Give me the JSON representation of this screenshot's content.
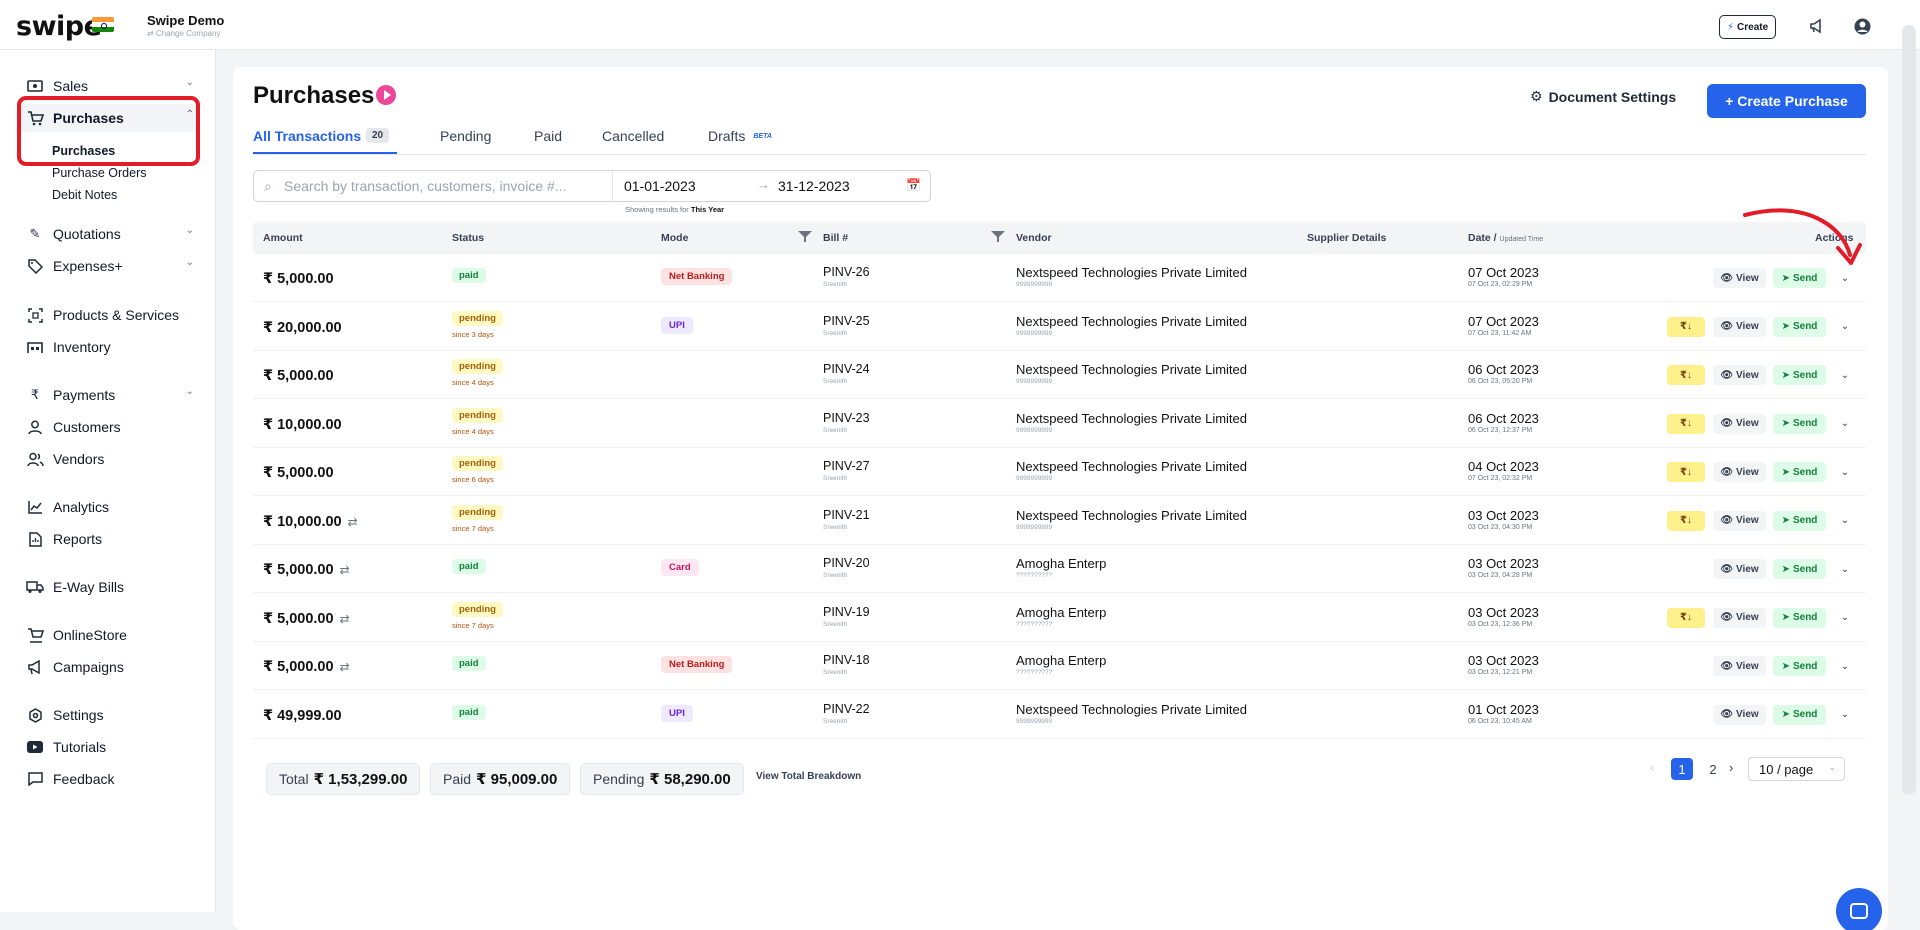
{
  "topbar": {
    "logo": "swipe",
    "company_name": "Swipe Demo",
    "change_company": "⇄ Change Company",
    "create_label": "Create"
  },
  "sidebar": {
    "items": [
      {
        "label": "Sales",
        "icon": "cash-icon",
        "chevron": "⌄"
      },
      {
        "label": "Purchases",
        "icon": "cart-icon",
        "chevron": "⌃"
      },
      {
        "label": "Quotations",
        "icon": "pen-icon",
        "chevron": "⌄"
      },
      {
        "label": "Expenses+",
        "icon": "tag-icon",
        "chevron": "⌄"
      },
      {
        "label": "Products & Services",
        "icon": "box-icon"
      },
      {
        "label": "Inventory",
        "icon": "warehouse-icon"
      },
      {
        "label": "Payments",
        "icon": "rupee-icon",
        "chevron": "⌄"
      },
      {
        "label": "Customers",
        "icon": "user-icon"
      },
      {
        "label": "Vendors",
        "icon": "users-icon"
      },
      {
        "label": "Analytics",
        "icon": "chart-icon"
      },
      {
        "label": "Reports",
        "icon": "report-icon"
      },
      {
        "label": "E-Way Bills",
        "icon": "truck-icon"
      },
      {
        "label": "OnlineStore",
        "icon": "store-icon"
      },
      {
        "label": "Campaigns",
        "icon": "megaphone-icon"
      },
      {
        "label": "Settings",
        "icon": "gear-icon"
      },
      {
        "label": "Tutorials",
        "icon": "youtube-icon"
      },
      {
        "label": "Feedback",
        "icon": "message-icon"
      }
    ],
    "sub_items": [
      "Purchases",
      "Purchase Orders",
      "Debit Notes"
    ]
  },
  "header": {
    "title": "Purchases",
    "doc_settings": "Document Settings",
    "create_purchase": "+ Create Purchase"
  },
  "tabs": {
    "all": "All Transactions",
    "all_count": "20",
    "pending": "Pending",
    "paid": "Paid",
    "cancelled": "Cancelled",
    "drafts": "Drafts",
    "beta": "BETA"
  },
  "filters": {
    "search_placeholder": "Search by transaction, customers, invoice #...",
    "date_from": "01-01-2023",
    "date_to": "31-12-2023",
    "showing_prefix": "Showing results for",
    "showing_period": "This Year"
  },
  "table": {
    "headers": {
      "amount": "Amount",
      "status": "Status",
      "mode": "Mode",
      "bill": "Bill #",
      "vendor": "Vendor",
      "supplier": "Supplier Details",
      "date": "Date /",
      "date_small": "Updated Time",
      "actions": "Actions"
    },
    "rows": [
      {
        "amount": "₹ 5,000.00",
        "repeat": "",
        "status": "paid",
        "since": "",
        "mode": "Net Banking",
        "mode_type": "net",
        "bill": "PINV-26",
        "bill_sub": "Sreenith",
        "vendor": "Nextspeed Technologies Private Limited",
        "vendor_sub": "9999999999",
        "date": "07 Oct 2023",
        "date_sub": "07 Oct 23, 02:29 PM",
        "pay": false
      },
      {
        "amount": "₹ 20,000.00",
        "repeat": "",
        "status": "pending",
        "since": "since 3 days",
        "mode": "UPI",
        "mode_type": "upi",
        "bill": "PINV-25",
        "bill_sub": "Sreenith",
        "vendor": "Nextspeed Technologies Private Limited",
        "vendor_sub": "9999999999",
        "date": "07 Oct 2023",
        "date_sub": "07 Oct 23, 11:42 AM",
        "pay": true
      },
      {
        "amount": "₹ 5,000.00",
        "repeat": "",
        "status": "pending",
        "since": "since 4 days",
        "mode": "",
        "mode_type": "",
        "bill": "PINV-24",
        "bill_sub": "Sreenith",
        "vendor": "Nextspeed Technologies Private Limited",
        "vendor_sub": "9999999999",
        "date": "06 Oct 2023",
        "date_sub": "06 Oct 23, 05:20 PM",
        "pay": true
      },
      {
        "amount": "₹ 10,000.00",
        "repeat": "",
        "status": "pending",
        "since": "since 4 days",
        "mode": "",
        "mode_type": "",
        "bill": "PINV-23",
        "bill_sub": "Sreenith",
        "vendor": "Nextspeed Technologies Private Limited",
        "vendor_sub": "9999999999",
        "date": "06 Oct 2023",
        "date_sub": "06 Oct 23, 12:37 PM",
        "pay": true
      },
      {
        "amount": "₹ 5,000.00",
        "repeat": "",
        "status": "pending",
        "since": "since 6 days",
        "mode": "",
        "mode_type": "",
        "bill": "PINV-27",
        "bill_sub": "Sreenith",
        "vendor": "Nextspeed Technologies Private Limited",
        "vendor_sub": "9999999999",
        "date": "04 Oct 2023",
        "date_sub": "07 Oct 23, 02:32 PM",
        "pay": true
      },
      {
        "amount": "₹ 10,000.00",
        "repeat": "⇄",
        "status": "pending",
        "since": "since 7 days",
        "mode": "",
        "mode_type": "",
        "bill": "PINV-21",
        "bill_sub": "Sreenith",
        "vendor": "Nextspeed Technologies Private Limited",
        "vendor_sub": "9999999999",
        "date": "03 Oct 2023",
        "date_sub": "03 Oct 23, 04:30 PM",
        "pay": true
      },
      {
        "amount": "₹ 5,000.00",
        "repeat": "⇄",
        "status": "paid",
        "since": "",
        "mode": "Card",
        "mode_type": "card",
        "bill": "PINV-20",
        "bill_sub": "Sreenith",
        "vendor": "Amogha Enterp",
        "vendor_sub": "??????????",
        "date": "03 Oct 2023",
        "date_sub": "03 Oct 23, 04:28 PM",
        "pay": false
      },
      {
        "amount": "₹ 5,000.00",
        "repeat": "⇄",
        "status": "pending",
        "since": "since 7 days",
        "mode": "",
        "mode_type": "",
        "bill": "PINV-19",
        "bill_sub": "Sreenith",
        "vendor": "Amogha Enterp",
        "vendor_sub": "??????????",
        "date": "03 Oct 2023",
        "date_sub": "03 Oct 23, 12:36 PM",
        "pay": true
      },
      {
        "amount": "₹ 5,000.00",
        "repeat": "⇄",
        "status": "paid",
        "since": "",
        "mode": "Net Banking",
        "mode_type": "net",
        "bill": "PINV-18",
        "bill_sub": "Sreenith",
        "vendor": "Amogha Enterp",
        "vendor_sub": "??????????",
        "date": "03 Oct 2023",
        "date_sub": "03 Oct 23, 12:21 PM",
        "pay": false
      },
      {
        "amount": "₹ 49,999.00",
        "repeat": "",
        "status": "paid",
        "since": "",
        "mode": "UPI",
        "mode_type": "upi",
        "bill": "PINV-22",
        "bill_sub": "Sreenith",
        "vendor": "Nextspeed Technologies Private Limited",
        "vendor_sub": "9999999999",
        "date": "01 Oct 2023",
        "date_sub": "06 Oct 23, 10:45 AM",
        "pay": false
      }
    ],
    "view_label": "View",
    "send_label": "Send",
    "pay_label": "₹↓"
  },
  "footer": {
    "total_label": "Total",
    "total_value": "₹ 1,53,299.00",
    "paid_label": "Paid",
    "paid_value": "₹ 95,009.00",
    "pending_label": "Pending",
    "pending_value": "₹ 58,290.00",
    "breakdown": "View Total Breakdown",
    "page_1": "1",
    "page_2": "2",
    "per_page": "10 / page"
  },
  "colors": {
    "accent": "#2563eb",
    "highlight": "#e11d2a"
  }
}
